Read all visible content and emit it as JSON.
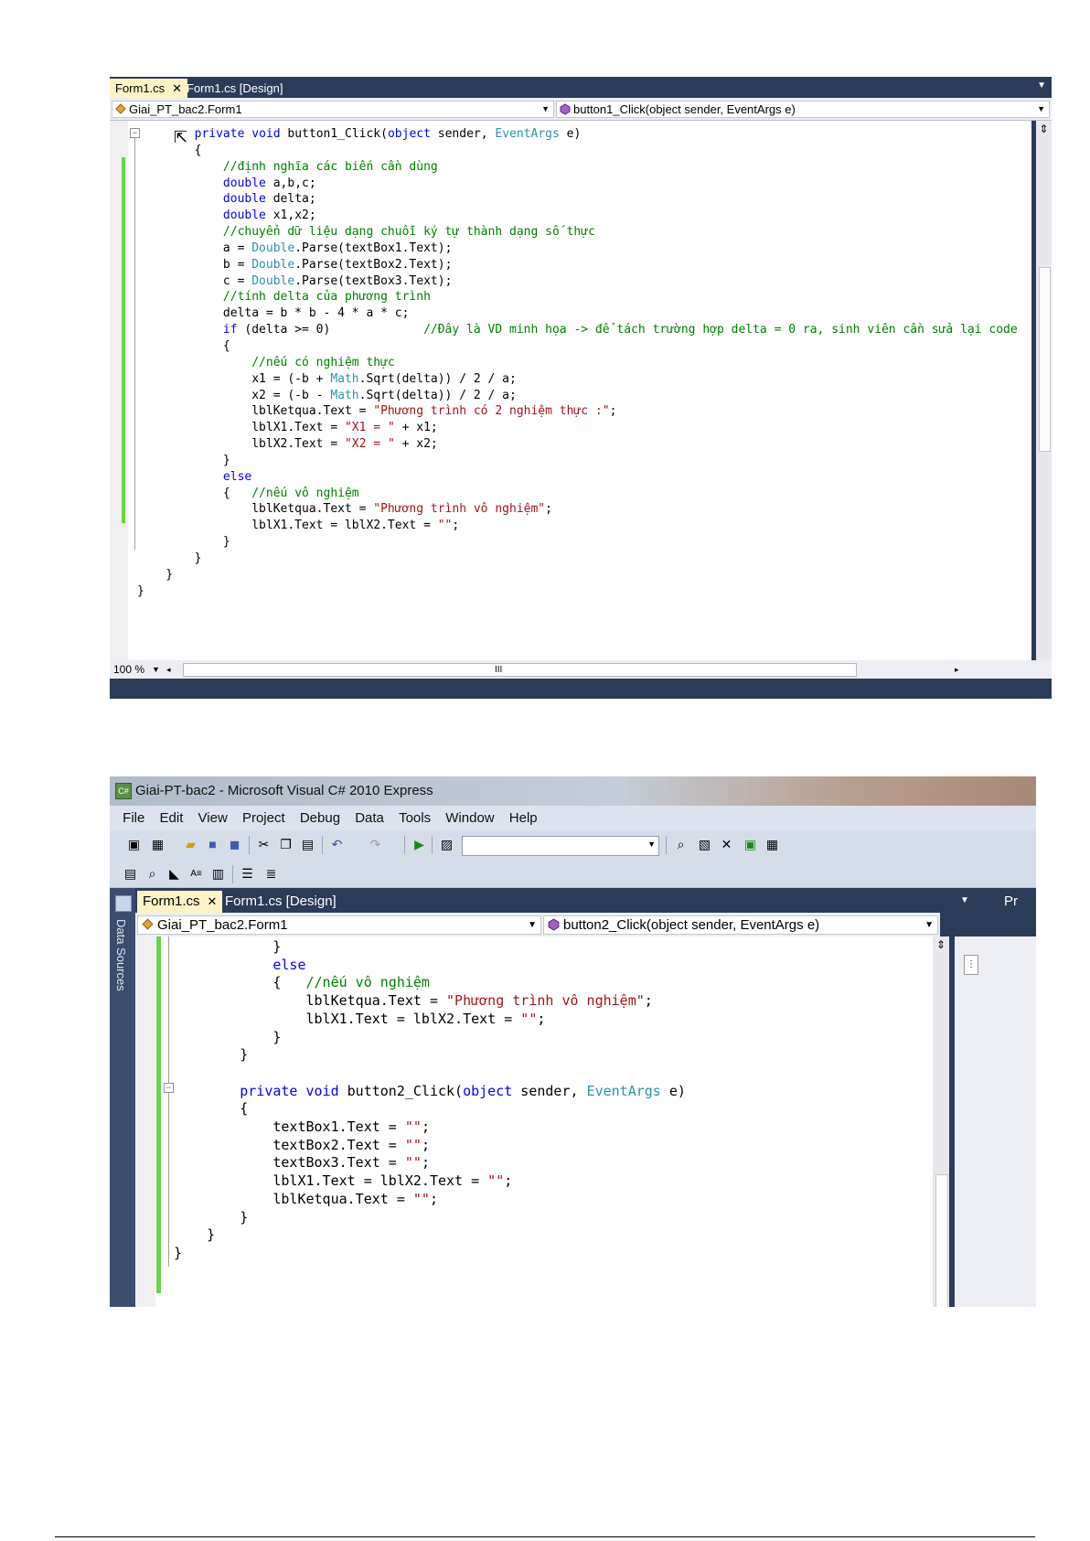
{
  "screenshot1": {
    "tabs": [
      {
        "label": "Form1.cs",
        "close": "✕",
        "active": true
      },
      {
        "label": "Form1.cs [Design]",
        "active": false
      }
    ],
    "nav": {
      "class_combo": "Giai_PT_bac2.Form1",
      "member_combo": "button1_Click(object sender, EventArgs e)"
    },
    "status": {
      "zoom": "100 %",
      "hscroll_marker": "III"
    },
    "code_lines": [
      "        private void button1_Click(object sender, EventArgs e)",
      "        {",
      "            //định nghĩa các biến cần dùng",
      "            double a,b,c;",
      "            double delta;",
      "            double x1,x2;",
      "            //chuyển dữ liệu dạng chuỗi ký tự thành dạng số thực",
      "            a = Double.Parse(textBox1.Text);",
      "            b = Double.Parse(textBox2.Text);",
      "            c = Double.Parse(textBox3.Text);",
      "            //tính delta của phương trình",
      "            delta = b * b - 4 * a * c;",
      "            if (delta >= 0)             //Đây là VD minh họa -> để tách trường hợp delta = 0 ra, sinh viên cần sửa lại code",
      "            {",
      "                //nếu có nghiệm thực",
      "                x1 = (-b + Math.Sqrt(delta)) / 2 / a;",
      "                x2 = (-b - Math.Sqrt(delta)) / 2 / a;",
      "                lblKetqua.Text = \"Phương trình có 2 nghiệm thực :\";",
      "                lblX1.Text = \"X1 = \" + x1;",
      "                lblX2.Text = \"X2 = \" + x2;",
      "            }",
      "            else",
      "            {   //nếu vô nghiệm",
      "                lblKetqua.Text = \"Phương trình vô nghiệm\";",
      "                lblX1.Text = lblX2.Text = \"\";",
      "            }",
      "        }",
      "    }",
      "}"
    ]
  },
  "screenshot2": {
    "window_title": "Giai-PT-bac2 - Microsoft Visual C# 2010 Express",
    "menu": [
      "File",
      "Edit",
      "View",
      "Project",
      "Debug",
      "Data",
      "Tools",
      "Window",
      "Help"
    ],
    "side_panel_label": "Data Sources",
    "tabs": [
      {
        "label": "Form1.cs",
        "close": "✕",
        "active": true
      },
      {
        "label": "Form1.cs [Design]",
        "active": false
      }
    ],
    "right_panel_label": "Pr",
    "nav": {
      "class_combo": "Giai_PT_bac2.Form1",
      "member_combo": "button2_Click(object sender, EventArgs e)"
    },
    "code_lines": [
      "            }",
      "            else",
      "            {   //nếu vô nghiệm",
      "                lblKetqua.Text = \"Phương trình vô nghiệm\";",
      "                lblX1.Text = lblX2.Text = \"\";",
      "            }",
      "        }",
      "",
      "        private void button2_Click(object sender, EventArgs e)",
      "        {",
      "            textBox1.Text = \"\";",
      "            textBox2.Text = \"\";",
      "            textBox3.Text = \"\";",
      "            lblX1.Text = lblX2.Text = \"\";",
      "            lblKetqua.Text = \"\";",
      "        }",
      "    }",
      "}"
    ]
  },
  "colors": {
    "keyword": "#0000ff",
    "type": "#2b91af",
    "comment": "#008000",
    "string": "#a31515",
    "active_tab": "#fef3c4",
    "ide_frame": "#2b3c59",
    "change_bar": "#6bd24b"
  },
  "icons": [
    "class-icon",
    "method-icon",
    "mouse-cursor-icon",
    "app-icon",
    "close-icon",
    "dropdown-arrow-icon"
  ]
}
